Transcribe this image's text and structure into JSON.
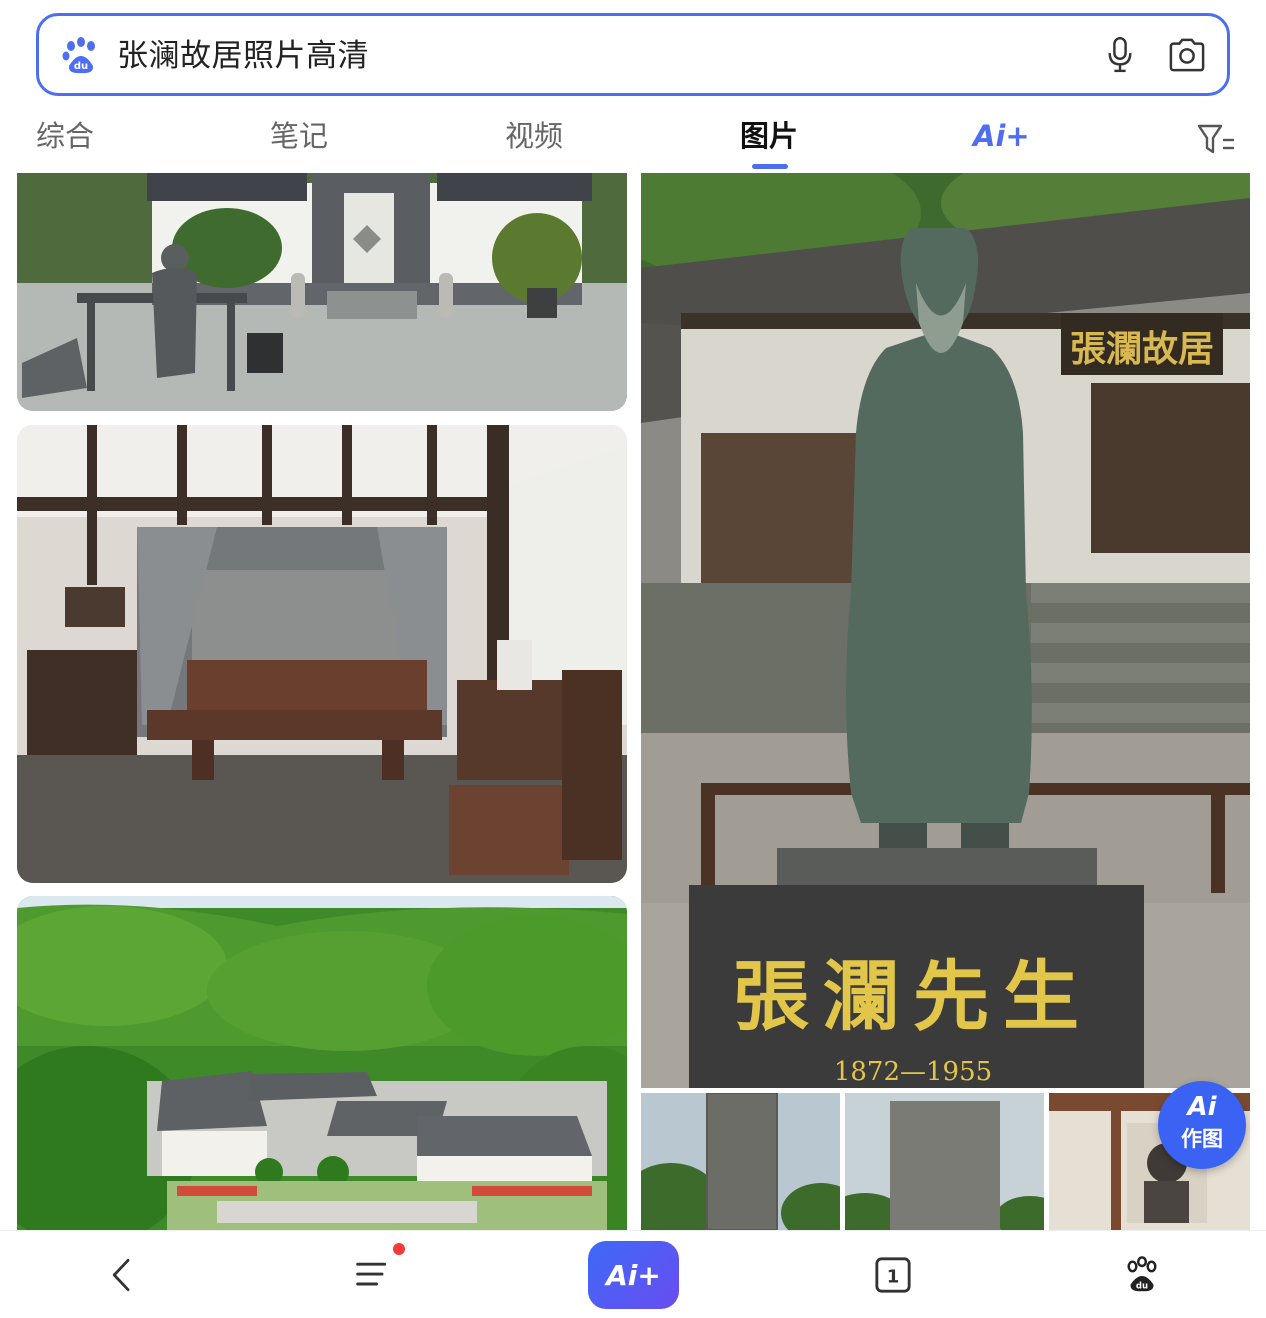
{
  "search": {
    "query": "张澜故居照片高清",
    "logo_icon": "baidu-paw-icon",
    "mic_icon": "microphone-icon",
    "camera_icon": "camera-search-icon"
  },
  "tabs": [
    {
      "label": "综合",
      "active": false
    },
    {
      "label": "笔记",
      "active": false
    },
    {
      "label": "视频",
      "active": false
    },
    {
      "label": "图片",
      "active": true
    }
  ],
  "ai_tab": {
    "label": "Ai+"
  },
  "filter_icon": "filter-icon",
  "images": {
    "statue_plaque": "張瀾先生",
    "statue_years": "1872—1955",
    "house_sign": "張瀾故居"
  },
  "ai_draw": {
    "line1": "Ai",
    "line2": "作图"
  },
  "bottom_nav": {
    "back_icon": "back-arrow-icon",
    "menu_icon": "menu-icon",
    "ai_label": "Ai+",
    "tabs_count": "1",
    "home_icon": "baidu-paw-icon"
  },
  "colors": {
    "accent": "#4e6ef2",
    "ai_fab": "#3a63f3",
    "notification_dot": "#f33b3b"
  }
}
